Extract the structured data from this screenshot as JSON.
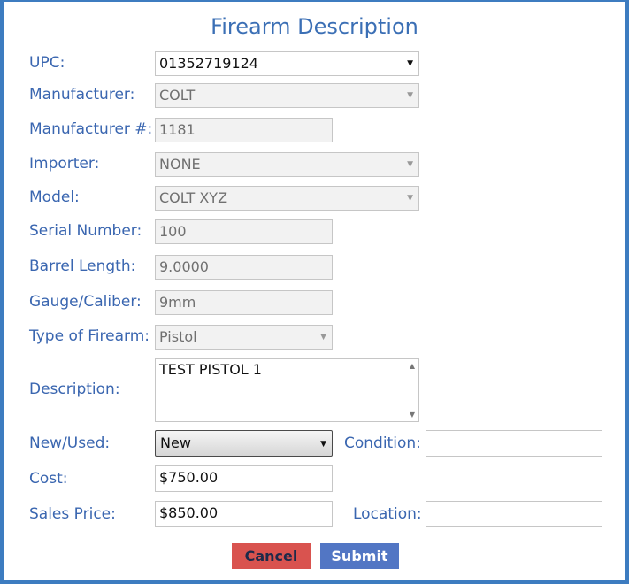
{
  "dialog": {
    "title": "Firearm Description"
  },
  "fields": {
    "upc": {
      "label": "UPC:",
      "value": "01352719124"
    },
    "manufacturer": {
      "label": "Manufacturer:",
      "value": "COLT"
    },
    "manufacturer_no": {
      "label": "Manufacturer #:",
      "value": "1181"
    },
    "importer": {
      "label": "Importer:",
      "value": "NONE"
    },
    "model": {
      "label": "Model:",
      "value": "COLT XYZ"
    },
    "serial_number": {
      "label": "Serial Number:",
      "value": "100"
    },
    "barrel_length": {
      "label": "Barrel Length:",
      "value": "9.0000"
    },
    "gauge_caliber": {
      "label": "Gauge/Caliber:",
      "value": "9mm"
    },
    "type_of_firearm": {
      "label": "Type of Firearm:",
      "value": "Pistol"
    },
    "description": {
      "label": "Description:",
      "value": "TEST PISTOL 1"
    },
    "new_used": {
      "label": "New/Used:",
      "value": "New"
    },
    "condition": {
      "label": "Condition:",
      "value": ""
    },
    "cost": {
      "label": "Cost:",
      "value": "$750.00"
    },
    "sales_price": {
      "label": "Sales Price:",
      "value": "$850.00"
    },
    "location": {
      "label": "Location:",
      "value": ""
    }
  },
  "buttons": {
    "cancel": "Cancel",
    "submit": "Submit"
  },
  "icons": {
    "dropdown": "chevron-down-icon",
    "scroll_up": "scroll-up-icon",
    "scroll_down": "scroll-down-icon"
  }
}
